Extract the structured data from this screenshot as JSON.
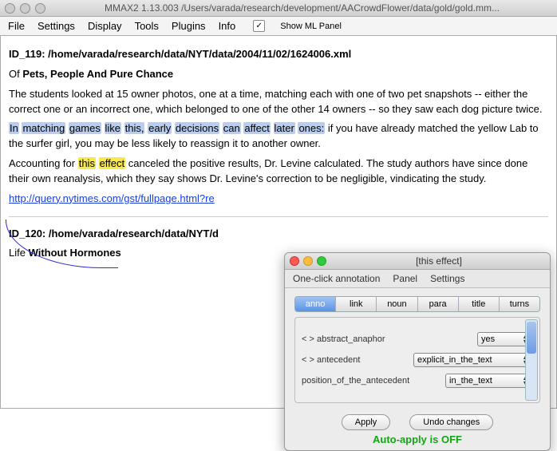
{
  "window": {
    "title": "MMAX2 1.13.003 /Users/varada/research/development/AACrowdFlower/data/gold/gold.mm..."
  },
  "menu": {
    "items": [
      "File",
      "Settings",
      "Display",
      "Tools",
      "Plugins",
      "Info"
    ],
    "show_ml_label": "Show ML Panel",
    "show_ml_checked": "✓"
  },
  "doc1": {
    "id_line": "ID_119: /home/varada/research/data/NYT/data/2004/11/02/1624006.xml",
    "of": "Of ",
    "title": "Pets, People And Pure Chance",
    "p1": "The students looked at 15 owner photos, one at a time, matching each with one of two pet snapshots -- either the correct one or an incorrect one, which belonged to one of the other 14 owners -- so they saw each dog picture twice.",
    "p2_hl": [
      "In",
      "matching",
      "games",
      "like",
      "this,",
      "early",
      "decisions",
      "can",
      "affect",
      "later",
      "ones:"
    ],
    "p2_rest": " if you have already matched the yellow Lab to the surfer girl, you may be less likely to reassign it to another owner.",
    "p3_pre": "Accounting for ",
    "p3_hl": [
      "this",
      "effect"
    ],
    "p3_post": " canceled the positive results, Dr. Levine calculated. The study authors have since done their own reanalysis, which they say shows Dr. Levine's correction to be negligible, vindicating the study.",
    "url": "http://query.nytimes.com/gst/fullpage.html?re"
  },
  "doc2": {
    "id_line": "ID_120: /home/varada/research/data/NYT/d",
    "of": "Life ",
    "title": "Without Hormones"
  },
  "panel": {
    "title": "[this effect]",
    "menu": [
      "One-click annotation",
      "Panel",
      "Settings"
    ],
    "tabs": [
      "anno",
      "link",
      "noun",
      "para",
      "title",
      "turns"
    ],
    "active_tab": 0,
    "rows": [
      {
        "label": "< > abstract_anaphor",
        "value": "yes"
      },
      {
        "label": "< > antecedent",
        "value": "explicit_in_the_text"
      },
      {
        "label": "position_of_the_antecedent",
        "value": "in_the_text"
      }
    ],
    "apply": "Apply",
    "undo": "Undo changes",
    "autoapply": "Auto-apply is OFF"
  }
}
